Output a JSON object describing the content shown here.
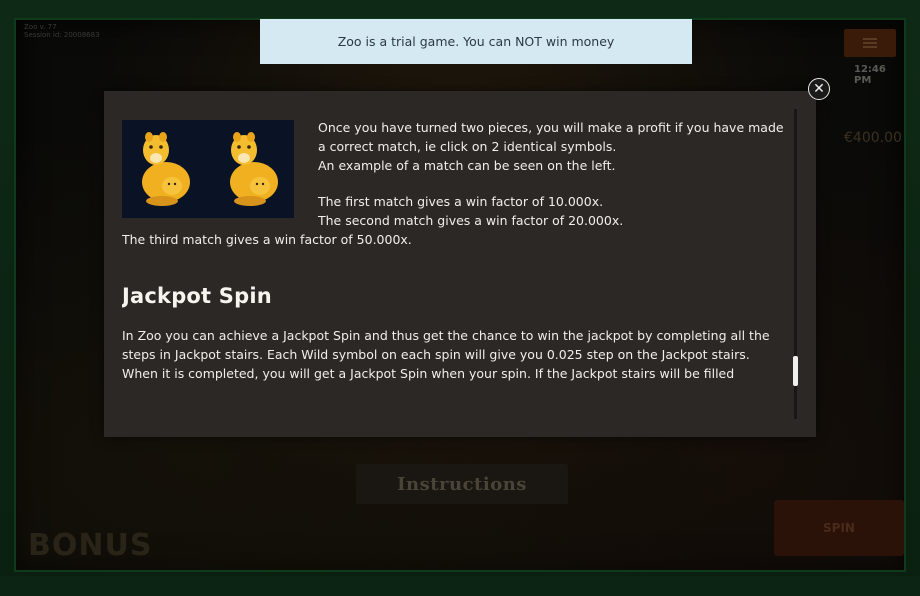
{
  "game": {
    "id_line1": "Zoo v. 77",
    "id_line2": "Session id: 20008683",
    "clock": "12:46 PM",
    "balance": "€400.00",
    "bonus_label": "BONUS",
    "spin_label": "SPIN",
    "instructions_tab": "Instructions"
  },
  "trial_banner": {
    "text": "Zoo is a trial game. You can NOT win money"
  },
  "modal": {
    "close_symbol": "✕",
    "match_intro": "Once you have turned two pieces, you will make a profit if you have made a correct match, ie click on 2 identical symbols.",
    "match_example": "An example of a match can be seen on the left.",
    "factor_first": "The first match gives a win factor of 10.000x.",
    "factor_second": "The second match gives a win factor of 20.000x.",
    "factor_third": "The third match gives a win factor of 50.000x.",
    "jackpot_heading": "Jackpot Spin",
    "jackpot_p1": "In Zoo you can achieve a Jackpot Spin and thus get the chance to win the jackpot by completing all the steps in Jackpot stairs. Each Wild symbol on each spin will give you 0.025 step on the Jackpot stairs.",
    "jackpot_p2": "When it is completed, you will get a Jackpot Spin when your spin. If the Jackpot stairs will be filled"
  },
  "icons": {
    "close": "close-icon",
    "menu": "hamburger-menu-icon",
    "symbol": "lioness-with-cub-icon"
  },
  "colors": {
    "banner_bg": "#d5e9f2",
    "modal_bg": "#2b2826",
    "frame_green": "#0f3a1c",
    "lion_gold": "#f2b52a"
  }
}
